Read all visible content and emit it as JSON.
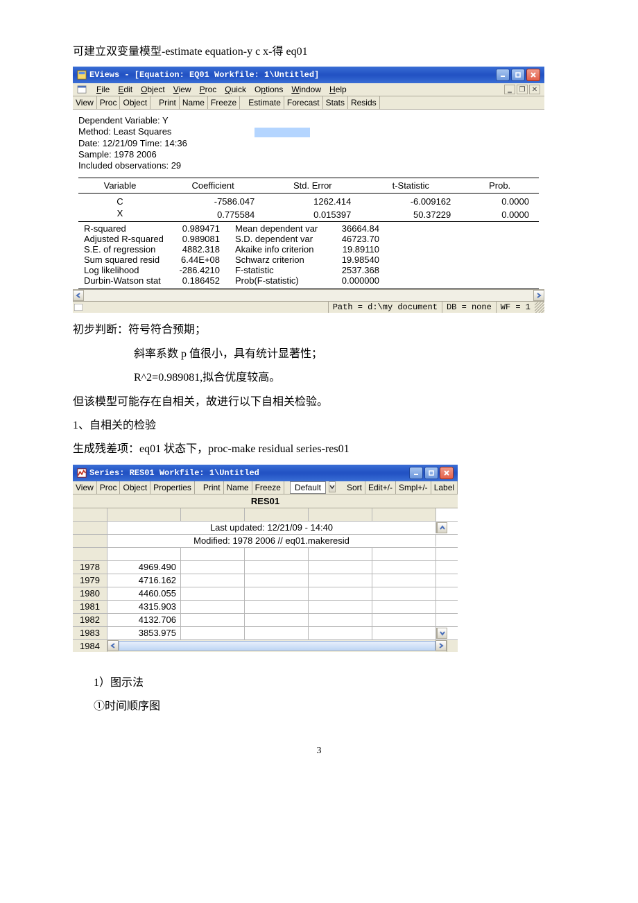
{
  "text": {
    "line1": "可建立双变量模型-estimate equation-y c x-得 eq01",
    "judge_intro": "初步判断：符号符合预期；",
    "judge_p": "斜率系数 p 值很小，具有统计显著性；",
    "judge_r2": "R^2=0.989081,拟合优度较高。",
    "autocorr_note": "但该模型可能存在自相关，故进行以下自相关检验。",
    "autocorr_head": "1、自相关的检验",
    "resid_gen": "生成残差项：eq01 状态下，proc-make residual series-res01",
    "method1": "1）图示法",
    "method1_1": "①时间顺序图",
    "page_num": "3"
  },
  "win1": {
    "title": "EViews - [Equation: EQ01   Workfile: 1\\Untitled]",
    "menus": [
      "File",
      "Edit",
      "Object",
      "View",
      "Proc",
      "Quick",
      "Options",
      "Window",
      "Help"
    ],
    "toolbar": [
      "View",
      "Proc",
      "Object",
      "Print",
      "Name",
      "Freeze",
      "Estimate",
      "Forecast",
      "Stats",
      "Resids"
    ],
    "header": {
      "l1": "Dependent Variable: Y",
      "l2": "Method: Least Squares",
      "l3": "Date: 12/21/09   Time: 14:36",
      "l4": "Sample: 1978 2006",
      "l5": "Included observations: 29"
    },
    "cols": [
      "Variable",
      "Coefficient",
      "Std. Error",
      "t-Statistic",
      "Prob."
    ],
    "rows": [
      {
        "v": "C",
        "coef": "-7586.047",
        "se": "1262.414",
        "t": "-6.009162",
        "p": "0.0000"
      },
      {
        "v": "X",
        "coef": "0.775584",
        "se": "0.015397",
        "t": "50.37229",
        "p": "0.0000"
      }
    ],
    "stats": [
      {
        "l": "R-squared",
        "v": "0.989471",
        "l2": "Mean dependent var",
        "v2": "36664.84"
      },
      {
        "l": "Adjusted R-squared",
        "v": "0.989081",
        "l2": "S.D. dependent var",
        "v2": "46723.70"
      },
      {
        "l": "S.E. of regression",
        "v": "4882.318",
        "l2": "Akaike info criterion",
        "v2": "19.89110"
      },
      {
        "l": "Sum squared resid",
        "v": "6.44E+08",
        "l2": "Schwarz criterion",
        "v2": "19.98540"
      },
      {
        "l": "Log likelihood",
        "v": "-286.4210",
        "l2": "F-statistic",
        "v2": "2537.368"
      },
      {
        "l": "Durbin-Watson stat",
        "v": "0.186452",
        "l2": "Prob(F-statistic)",
        "v2": "0.000000"
      }
    ],
    "status": {
      "path": "Path = d:\\my document",
      "db": "DB = none",
      "wf": "WF = 1"
    }
  },
  "win2": {
    "title": "Series: RES01   Workfile: 1\\Untitled",
    "toolbar_l": [
      "View",
      "Proc",
      "Object",
      "Properties",
      "Print",
      "Name",
      "Freeze"
    ],
    "toolbar_default": "Default",
    "toolbar_r": [
      "Sort",
      "Edit+/-",
      "Smpl+/-",
      "Label"
    ],
    "label": "RES01",
    "info1": "Last updated: 12/21/09 - 14:40",
    "info2": "Modified: 1978 2006 // eq01.makeresid",
    "rows": [
      {
        "y": "1978",
        "v": "4969.490"
      },
      {
        "y": "1979",
        "v": "4716.162"
      },
      {
        "y": "1980",
        "v": "4460.055"
      },
      {
        "y": "1981",
        "v": "4315.903"
      },
      {
        "y": "1982",
        "v": "4132.706"
      },
      {
        "y": "1983",
        "v": "3853.975"
      }
    ],
    "last_year": "1984"
  }
}
